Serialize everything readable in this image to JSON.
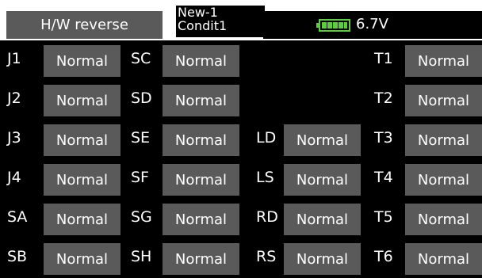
{
  "header": {
    "title": "H/W reverse",
    "model_name": "New-1",
    "condition": "Condit1",
    "voltage": "6.7V"
  },
  "rows": [
    {
      "a": {
        "label": "J1",
        "value": "Normal"
      },
      "b": {
        "label": "SC",
        "value": "Normal"
      },
      "c": null,
      "d": {
        "label": "T1",
        "value": "Normal"
      }
    },
    {
      "a": {
        "label": "J2",
        "value": "Normal"
      },
      "b": {
        "label": "SD",
        "value": "Normal"
      },
      "c": null,
      "d": {
        "label": "T2",
        "value": "Normal"
      }
    },
    {
      "a": {
        "label": "J3",
        "value": "Normal"
      },
      "b": {
        "label": "SE",
        "value": "Normal"
      },
      "c": {
        "label": "LD",
        "value": "Normal"
      },
      "d": {
        "label": "T3",
        "value": "Normal"
      }
    },
    {
      "a": {
        "label": "J4",
        "value": "Normal"
      },
      "b": {
        "label": "SF",
        "value": "Normal"
      },
      "c": {
        "label": "LS",
        "value": "Normal"
      },
      "d": {
        "label": "T4",
        "value": "Normal"
      }
    },
    {
      "a": {
        "label": "SA",
        "value": "Normal"
      },
      "b": {
        "label": "SG",
        "value": "Normal"
      },
      "c": {
        "label": "RD",
        "value": "Normal"
      },
      "d": {
        "label": "T5",
        "value": "Normal"
      }
    },
    {
      "a": {
        "label": "SB",
        "value": "Normal"
      },
      "b": {
        "label": "SH",
        "value": "Normal"
      },
      "c": {
        "label": "RS",
        "value": "Normal"
      },
      "d": {
        "label": "T6",
        "value": "Normal"
      }
    }
  ],
  "colors": {
    "button_bg": "#5a5a5a",
    "battery_green": "#5ad13c"
  },
  "icons": {
    "battery": "battery-icon",
    "menu_pointer": "triangle-down-icon"
  }
}
